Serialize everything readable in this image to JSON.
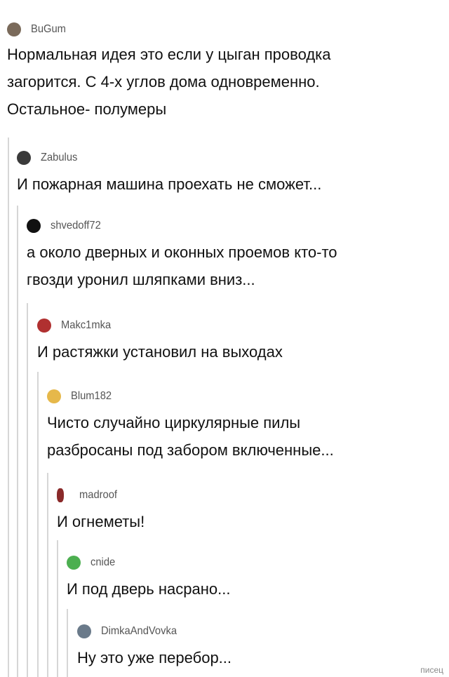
{
  "comments": [
    {
      "user": "BuGum",
      "text": "Нормальная идея это если у цыган проводка\nзагорится. С 4-х углов дома одновременно.\nОстальное- полумеры",
      "avatar_color": "#7a6a5a"
    },
    {
      "user": "Zabulus",
      "text": "И пожарная машина проехать не сможет...",
      "avatar_color": "#3a3a3a"
    },
    {
      "user": "shvedoff72",
      "text": "а около дверных и оконных проемов кто-то\nгвозди уронил шляпками вниз...",
      "avatar_color": "#111111"
    },
    {
      "user": "Makc1mka",
      "text": "И растяжки установил на выходах",
      "avatar_color": "#b03030"
    },
    {
      "user": "Blum182",
      "text": "Чисто случайно циркулярные пилы\nразбросаны под забором включенные...",
      "avatar_color": "#e6b84a"
    },
    {
      "user": "madroof",
      "text": "И огнеметы!",
      "avatar_color": "#8a2a2a"
    },
    {
      "user": "cnide",
      "text": "И под дверь насрано...",
      "avatar_color": "#4caf50"
    },
    {
      "user": "DimkaAndVovka",
      "text": "Ну это уже перебор...",
      "avatar_color": "#6a7a8a"
    }
  ],
  "watermark": "писец",
  "rail_color": "#d6d6d6"
}
